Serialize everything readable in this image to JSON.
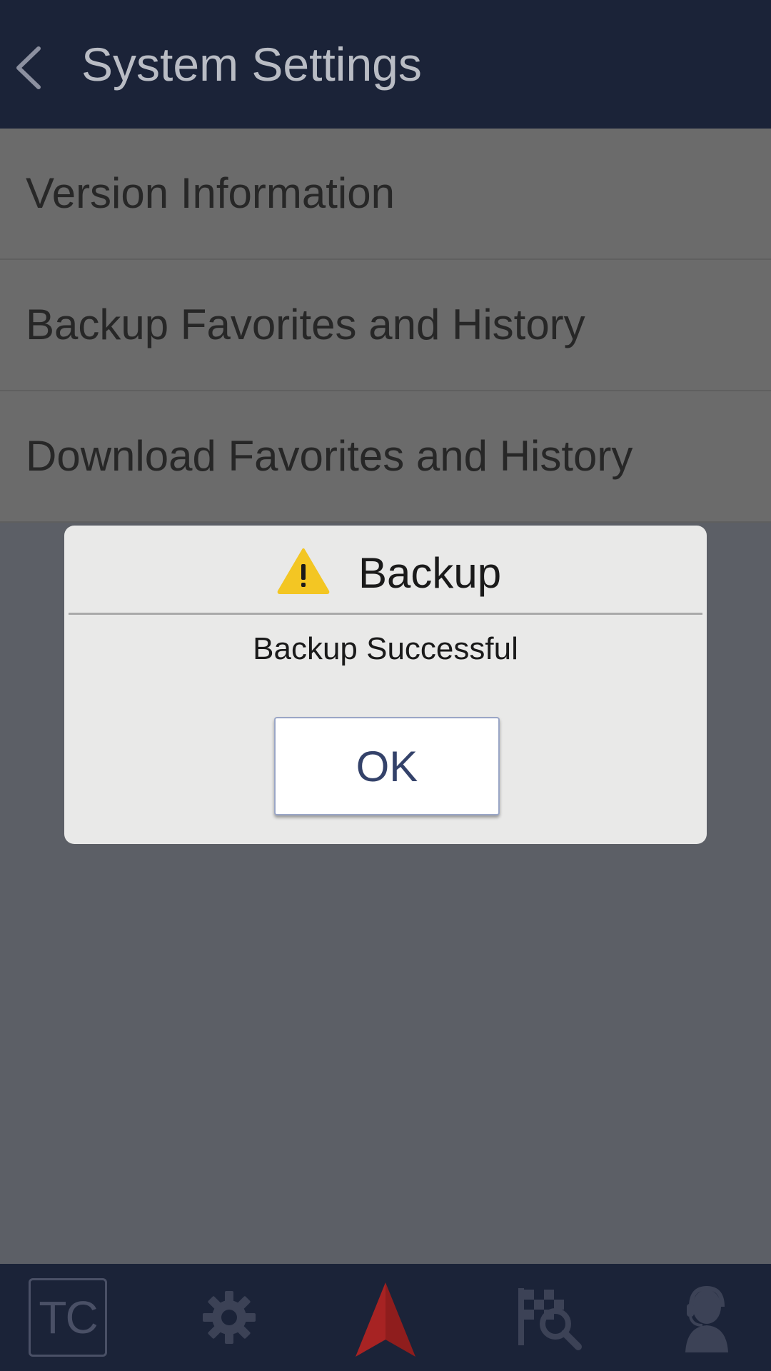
{
  "header": {
    "title": "System Settings",
    "back_icon": "chevron-left-icon"
  },
  "settings_list": [
    {
      "label": "Version Information"
    },
    {
      "label": "Backup Favorites and History"
    },
    {
      "label": "Download Favorites and History"
    }
  ],
  "dialog": {
    "icon": "warning-icon",
    "title": "Backup",
    "message": "Backup Successful",
    "ok_label": "OK"
  },
  "bottom_nav": {
    "tc_label": "TC",
    "items": [
      "tc-icon",
      "gear-icon",
      "navigation-arrow-icon",
      "checkered-flag-search-icon",
      "support-agent-icon"
    ]
  },
  "colors": {
    "header_bg": "#1b2338",
    "dialog_bg": "#e9e9e8",
    "warning": "#f3c623",
    "accent_text": "#34426a"
  }
}
